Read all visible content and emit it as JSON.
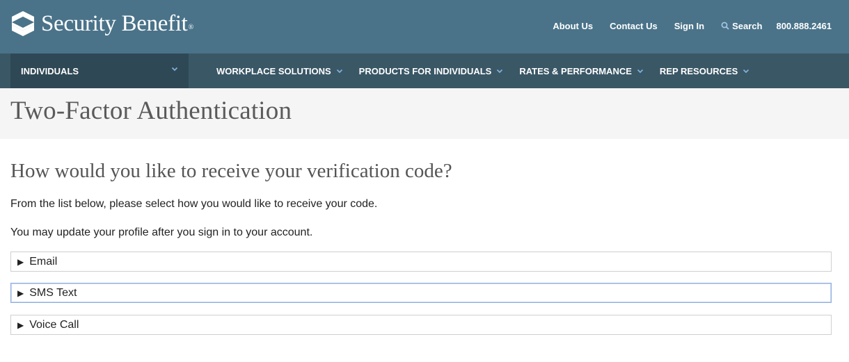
{
  "header": {
    "logo_text": "Security Benefit",
    "logo_reg": "®",
    "utility_links": {
      "about": "About Us",
      "contact": "Contact Us",
      "signin": "Sign In",
      "search": "Search",
      "phone": "800.888.2461"
    },
    "colors": {
      "topbar": "#4a7389",
      "navbar": "#3a5766",
      "nav_active": "#2f4855"
    }
  },
  "nav": {
    "individuals": "INDIVIDUALS",
    "items": [
      {
        "label": "WORKPLACE SOLUTIONS"
      },
      {
        "label": "PRODUCTS FOR INDIVIDUALS"
      },
      {
        "label": "RATES & PERFORMANCE"
      },
      {
        "label": "REP RESOURCES"
      }
    ]
  },
  "page": {
    "title": "Two-Factor Authentication",
    "heading": "How would you like to receive your verification code?",
    "paragraph1": "From the list below, please select how you would like to receive your code.",
    "paragraph2": "You may update your profile after you sign in to your account.",
    "options": [
      {
        "label": "Email",
        "marker": "▶"
      },
      {
        "label": "SMS Text",
        "marker": "▶"
      },
      {
        "label": "Voice Call",
        "marker": "▶"
      }
    ]
  }
}
